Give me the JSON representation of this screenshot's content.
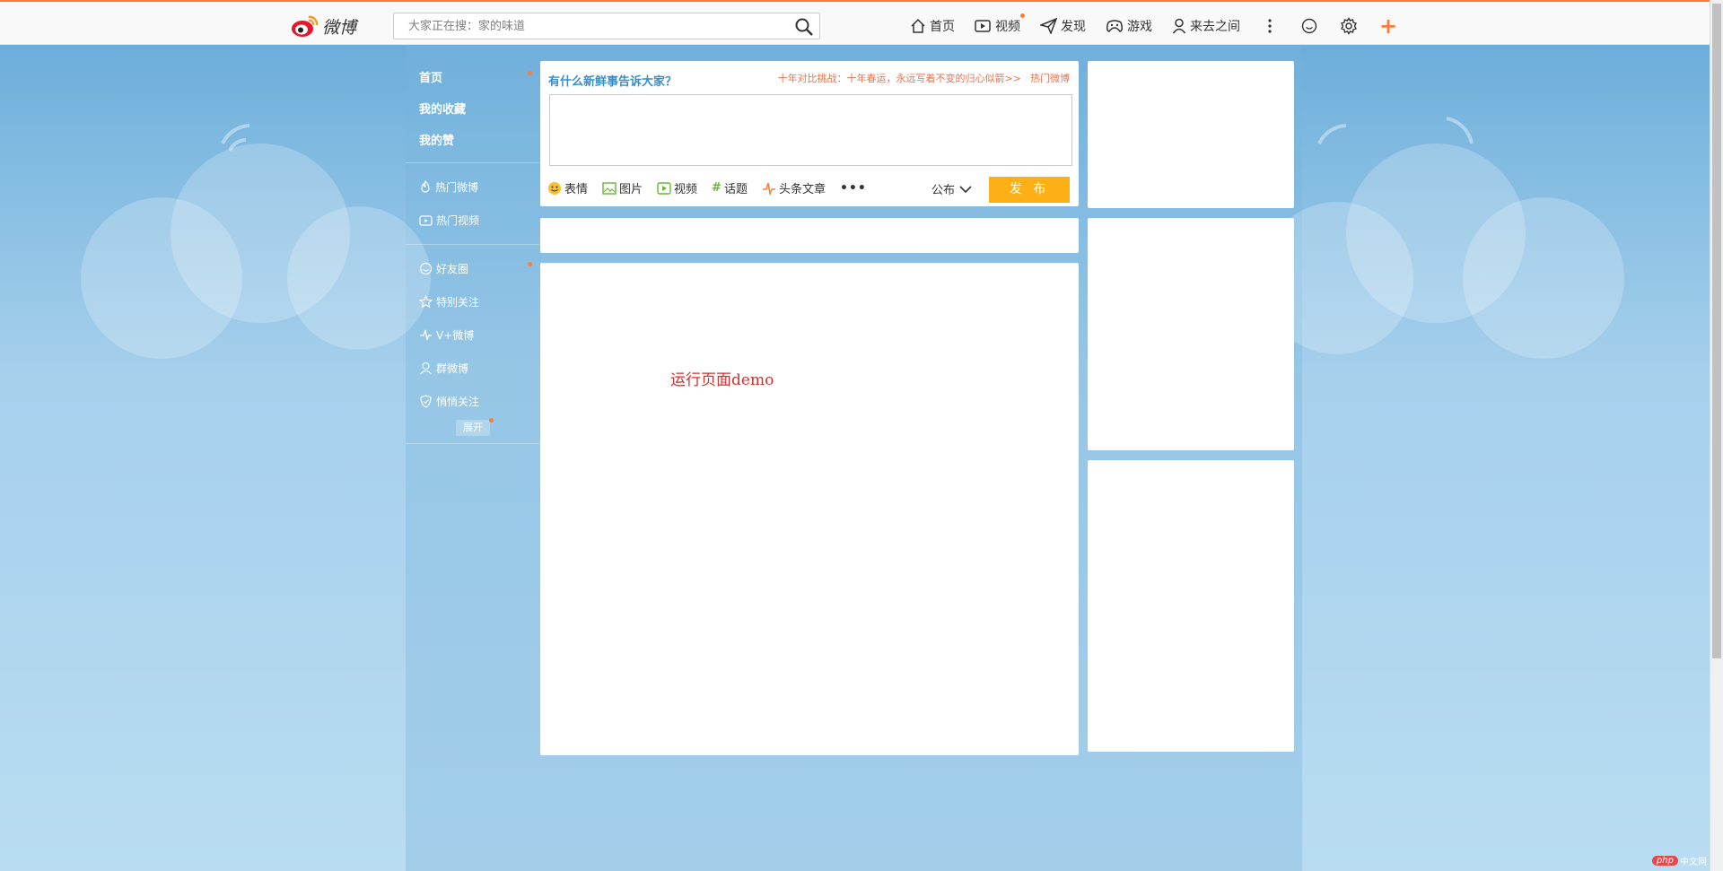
{
  "colors": {
    "accent": "#fa7d3c",
    "link_blue": "#3b8ec6",
    "post_button": "#fcb016",
    "demo_red": "#d0312d"
  },
  "brand": {
    "name": "微博"
  },
  "search": {
    "placeholder": "大家正在搜：家的味道",
    "icon": "search-icon"
  },
  "topnav": {
    "items": [
      {
        "label": "首页",
        "icon": "home-icon"
      },
      {
        "label": "视频",
        "icon": "video-icon"
      },
      {
        "label": "发现",
        "icon": "paper-plane-icon"
      },
      {
        "label": "游戏",
        "icon": "gamepad-icon"
      },
      {
        "label": "来去之间",
        "icon": "user-icon"
      }
    ],
    "icons": [
      "more-vertical-icon",
      "smiley-icon",
      "gear-icon",
      "plus-icon"
    ]
  },
  "leftnav": {
    "top": [
      "首页",
      "我的收藏",
      "我的赞"
    ],
    "hot": [
      "热门微博",
      "热门视频"
    ],
    "groups": [
      "好友圈",
      "特别关注",
      "V+微博",
      "群微博",
      "悄悄关注"
    ],
    "expand": "展开"
  },
  "publisher": {
    "prompt": "有什么新鲜事告诉大家？",
    "hot_topic": "十年对比挑战：十年春运，永远写着不变的归心似箭>>",
    "hot_link": "热门微博",
    "tools": [
      "表情",
      "图片",
      "视频",
      "话题",
      "头条文章"
    ],
    "more": "•••",
    "visibility": "公布",
    "submit": "发 布"
  },
  "feed": {
    "demo_text": "运行页面demo"
  },
  "watermark": {
    "badge": "php",
    "text": "中文网"
  }
}
